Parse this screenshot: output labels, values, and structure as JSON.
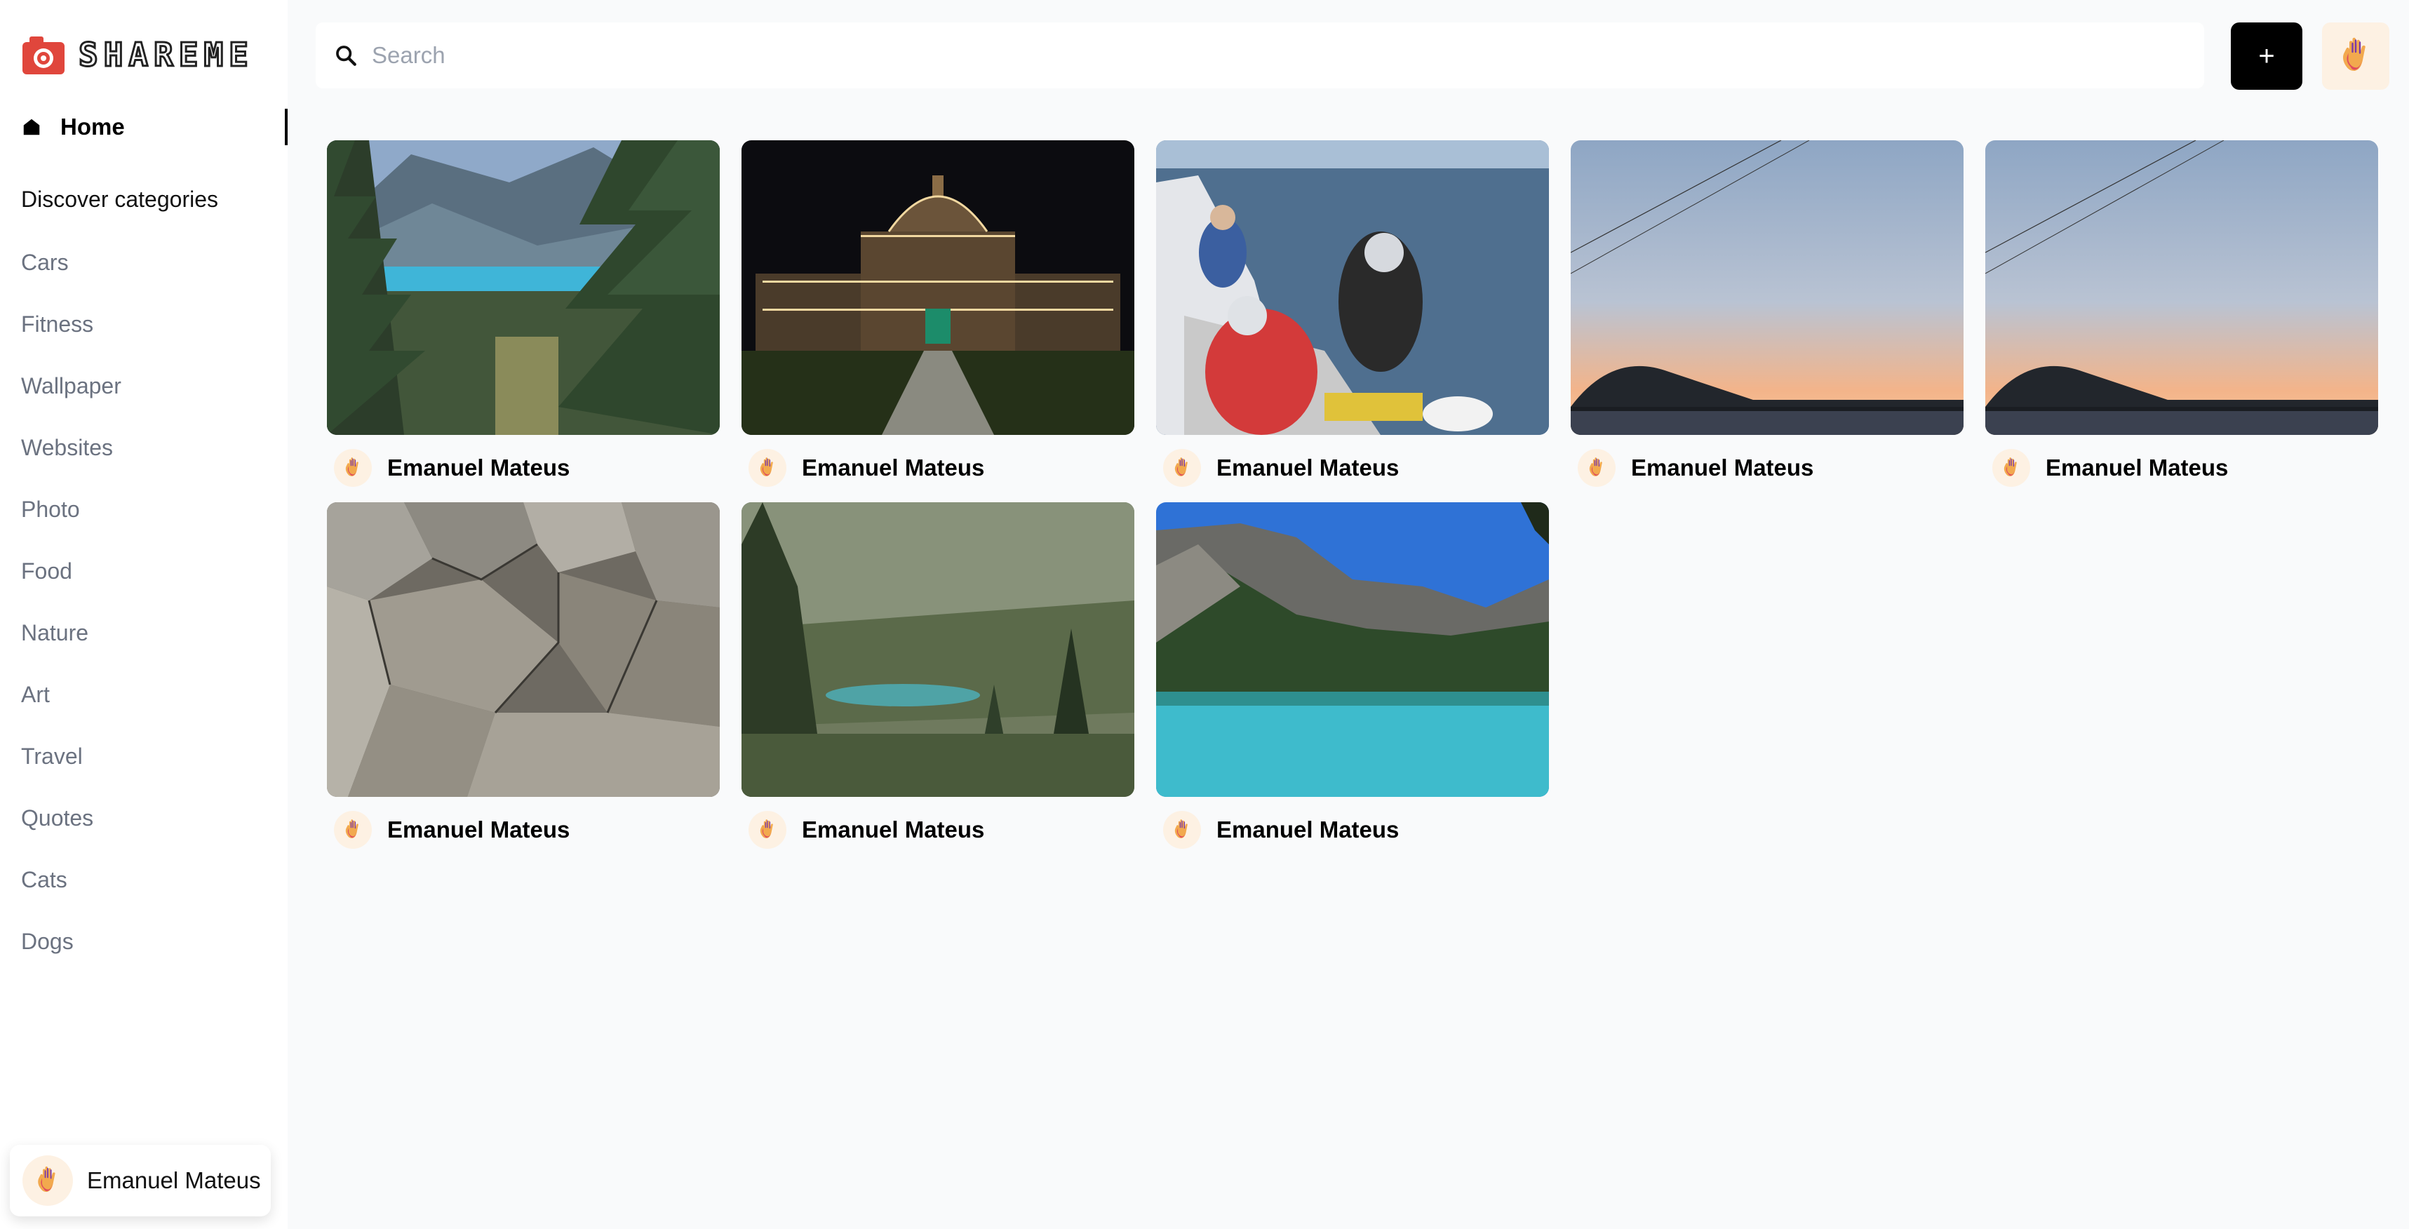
{
  "brand": {
    "name": "SHAREME"
  },
  "sidebar": {
    "home_label": "Home",
    "discover_label": "Discover categories",
    "categories": [
      "Cars",
      "Fitness",
      "Wallpaper",
      "Websites",
      "Photo",
      "Food",
      "Nature",
      "Art",
      "Travel",
      "Quotes",
      "Cats",
      "Dogs"
    ],
    "user_name": "Emanuel Mateus"
  },
  "search": {
    "placeholder": "Search",
    "value": ""
  },
  "toolbar": {
    "add_label": "+"
  },
  "pins": [
    {
      "author": "Emanuel Mateus",
      "image": "mountain-lake-pines"
    },
    {
      "author": "Emanuel Mateus",
      "image": "parliament-night-lights"
    },
    {
      "author": "Emanuel Mateus",
      "image": "boat-tour-people"
    },
    {
      "author": "Emanuel Mateus",
      "image": "sunset-bay"
    },
    {
      "author": "Emanuel Mateus",
      "image": "sunset-bay"
    },
    {
      "author": "Emanuel Mateus",
      "image": "granite-rocks"
    },
    {
      "author": "Emanuel Mateus",
      "image": "forest-valley-lake"
    },
    {
      "author": "Emanuel Mateus",
      "image": "turquoise-lake-mountains"
    }
  ],
  "colors": {
    "brand_red": "#e0463c",
    "accent": "#000000",
    "background": "#f9fafb"
  }
}
